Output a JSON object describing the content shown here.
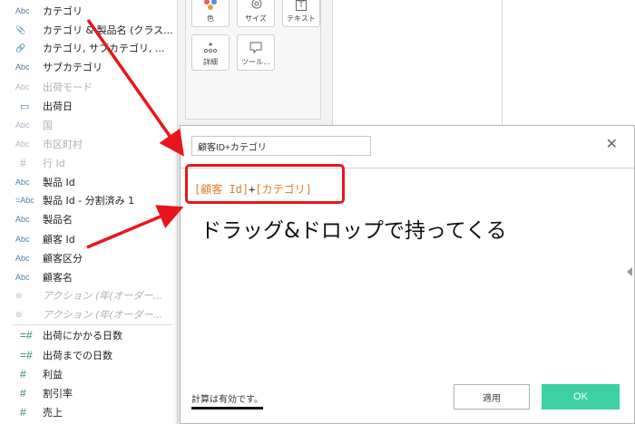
{
  "data_pane": {
    "fields": [
      {
        "icon": "Abc",
        "label": "カテゴリ",
        "style": "normal"
      },
      {
        "icon": "📎",
        "label": "カテゴリ & 製品名 (クラス...",
        "style": "normal"
      },
      {
        "icon": "🔗",
        "label": "カテゴリ, サブカテゴリ, ...",
        "style": "normal"
      },
      {
        "icon": "Abc",
        "label": "サブカテゴリ",
        "style": "normal"
      },
      {
        "icon": "Abc",
        "label": "出荷モード",
        "style": "dim"
      },
      {
        "icon": "▭",
        "label": "出荷日",
        "style": "normal"
      },
      {
        "icon": "Abc",
        "label": "国",
        "style": "dim"
      },
      {
        "icon": "Abc",
        "label": "市区町村",
        "style": "dim"
      },
      {
        "icon": "#",
        "label": "行 Id",
        "style": "dim"
      },
      {
        "icon": "Abc",
        "label": "製品 Id",
        "style": "normal"
      },
      {
        "icon": "=Abc",
        "label": "製品 Id - 分割済み 1",
        "style": "normal"
      },
      {
        "icon": "Abc",
        "label": "製品名",
        "style": "normal"
      },
      {
        "icon": "Abc",
        "label": "顧客 Id",
        "style": "normal"
      },
      {
        "icon": "Abc",
        "label": "顧客区分",
        "style": "normal"
      },
      {
        "icon": "Abc",
        "label": "顧客名",
        "style": "normal"
      },
      {
        "icon": "⊚",
        "label": "アクション (年(オーダー...",
        "style": "italic"
      },
      {
        "icon": "⊚",
        "label": "アクション (年(オーダー...",
        "style": "italic"
      },
      {
        "icon": "=#",
        "label": "出荷にかかる日数",
        "style": "normal"
      },
      {
        "icon": "=#",
        "label": "出荷までの日数",
        "style": "normal"
      },
      {
        "icon": "#",
        "label": "利益",
        "style": "normal"
      },
      {
        "icon": "#",
        "label": "割引率",
        "style": "normal"
      },
      {
        "icon": "#",
        "label": "売上",
        "style": "normal"
      }
    ]
  },
  "marks": {
    "color_label": "色",
    "size_label": "サイズ",
    "text_label": "テキスト",
    "detail_label": "詳細",
    "tooltip_label": "ツール...",
    "text_icon": "T"
  },
  "dialog": {
    "name_value": "顧客ID+カテゴリ",
    "close_glyph": "✕",
    "formula_field1": "[顧客 Id]",
    "formula_op": "+",
    "formula_field2": "[カテゴリ]",
    "annotation": "ドラッグ&ドロップで持ってくる",
    "status": "計算は有効です。",
    "apply_label": "適用",
    "ok_label": "OK"
  },
  "colors": {
    "accent_ok": "#3dd0a2",
    "highlight_red": "#e8161c",
    "field_orange": "#e07b2a"
  }
}
